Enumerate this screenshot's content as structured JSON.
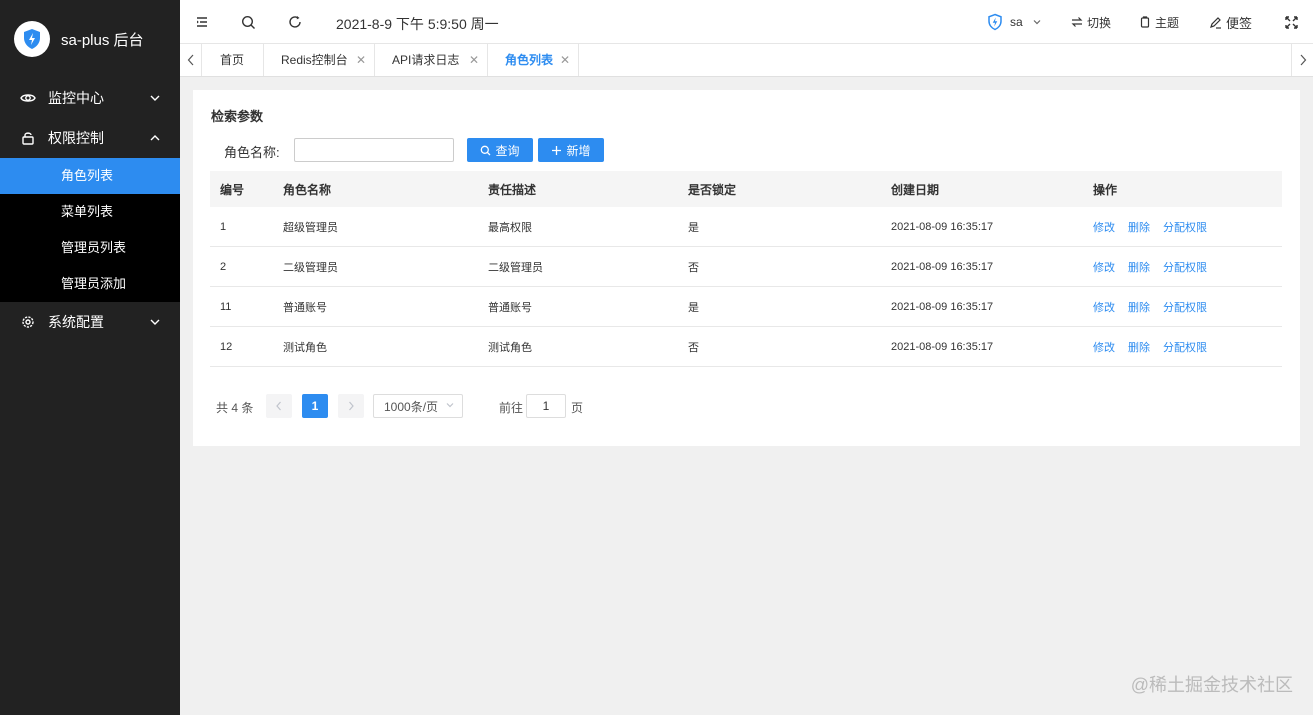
{
  "sidebar": {
    "brand": "sa-plus 后台",
    "groups": [
      {
        "label": "监控中心",
        "expanded": false
      },
      {
        "label": "权限控制",
        "expanded": true
      },
      {
        "label": "系统配置",
        "expanded": false
      }
    ],
    "sub_items": [
      "角色列表",
      "菜单列表",
      "管理员列表",
      "管理员添加"
    ],
    "active_sub_item": "角色列表"
  },
  "navbar": {
    "datetime": "2021-8-9 下午 5:9:50 周一",
    "user": "sa",
    "switch_label": "切换",
    "theme_label": "主题",
    "note_label": "便签"
  },
  "tabs": [
    {
      "label": "首页",
      "closable": false
    },
    {
      "label": "Redis控制台",
      "closable": true
    },
    {
      "label": "API请求日志",
      "closable": true
    },
    {
      "label": "角色列表",
      "closable": true,
      "active": true
    }
  ],
  "search": {
    "title": "检索参数",
    "field_label": "角色名称:",
    "field_value": "",
    "query_button": "查询",
    "add_button": "新增"
  },
  "table": {
    "headers": [
      "编号",
      "角色名称",
      "责任描述",
      "是否锁定",
      "创建日期",
      "操作"
    ],
    "rows": [
      [
        "1",
        "超级管理员",
        "最高权限",
        "是",
        "2021-08-09 16:35:17"
      ],
      [
        "2",
        "二级管理员",
        "二级管理员",
        "否",
        "2021-08-09 16:35:17"
      ],
      [
        "11",
        "普通账号",
        "普通账号",
        "是",
        "2021-08-09 16:35:17"
      ],
      [
        "12",
        "测试角色",
        "测试角色",
        "否",
        "2021-08-09 16:35:17"
      ]
    ],
    "actions": [
      "修改",
      "删除",
      "分配权限"
    ]
  },
  "pagination": {
    "total_text": "共 4 条",
    "current_page": "1",
    "page_size": "1000条/页",
    "goto_label": "前往",
    "goto_value": "1",
    "goto_unit": "页"
  },
  "watermark": "@稀土掘金技术社区",
  "colors": {
    "sidebar_bg": "#222222",
    "submenu_bg": "#000000",
    "accent": "#2d8cf0"
  }
}
